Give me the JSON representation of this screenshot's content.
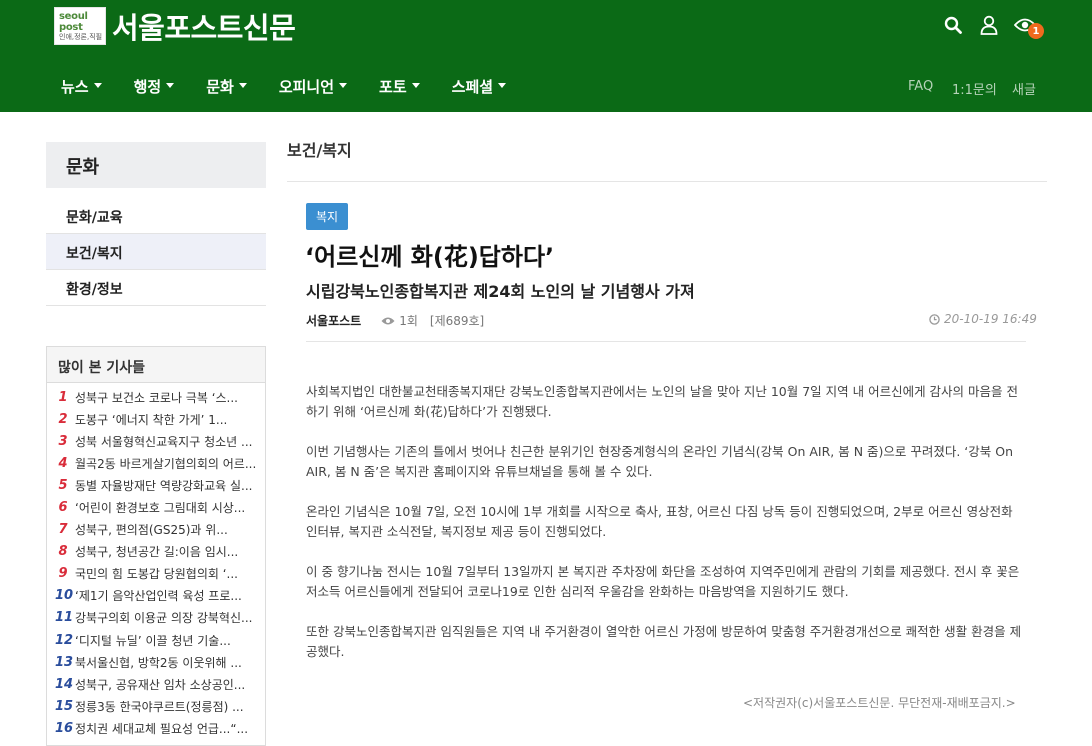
{
  "header": {
    "logo_top": "seoul post",
    "logo_bottom": "인애,정론,직필",
    "site_title": "서울포스트신문",
    "eye_badge": "1",
    "nav": [
      "뉴스",
      "행정",
      "문화",
      "오피니언",
      "포토",
      "스페셜"
    ],
    "util": [
      "FAQ",
      "1:1문의",
      "새글"
    ]
  },
  "sidebar": {
    "title": "문화",
    "items": [
      "문화/교육",
      "보건/복지",
      "환경/정보"
    ],
    "popular_title": "많이 본 기사들",
    "popular": [
      {
        "num": "1",
        "text": "성북구 보건소 코로나 극복 ‘스..."
      },
      {
        "num": "2",
        "text": "도봉구 ‘에너지 착한 가게’ 1..."
      },
      {
        "num": "3",
        "text": "성북 서울형혁신교육지구 청소년 ..."
      },
      {
        "num": "4",
        "text": "월곡2동 바르게살기협의회의 어르..."
      },
      {
        "num": "5",
        "text": "동별 자율방재단 역량강화교육 실..."
      },
      {
        "num": "6",
        "text": "‘어린이 환경보호 그림대회 시상..."
      },
      {
        "num": "7",
        "text": "성북구, 편의점(GS25)과 위..."
      },
      {
        "num": "8",
        "text": "성북구, 청년공간 길:이음 임시..."
      },
      {
        "num": "9",
        "text": "국민의 힘 도봉갑 당원협의회 ‘..."
      },
      {
        "num": "10",
        "text": "‘제1기 음악산업인력 육성 프로..."
      },
      {
        "num": "11",
        "text": "강북구의회 이용균 의장 강북혁신..."
      },
      {
        "num": "12",
        "text": "‘디지털 뉴딜’ 이끌 청년 기술..."
      },
      {
        "num": "13",
        "text": "북서울신협, 방학2동 이웃위해 ..."
      },
      {
        "num": "14",
        "text": "성북구, 공유재산 임차 소상공인..."
      },
      {
        "num": "15",
        "text": "정릉3동 한국야쿠르트(정릉점) ..."
      },
      {
        "num": "16",
        "text": "정치권 세대교체 필요성 언급...“..."
      }
    ]
  },
  "article": {
    "section": "보건/복지",
    "tag": "복지",
    "title": "‘어르신께 화(花)답하다’",
    "subtitle": "시립강북노인종합복지관 제24회 노인의 날 기념행사 가져",
    "author": "서울포스트",
    "views": "1회",
    "issue": "[제689호]",
    "date": "20-10-19 16:49",
    "paragraphs": [
      "사회복지법인 대한불교천태종복지재단 강북노인종합복지관에서는 노인의 날을 맞아 지난 10월 7일 지역 내 어르신에게 감사의 마음을 전하기 위해 ‘어르신께 화(花)답하다’가 진행됐다.",
      " 이번 기념행사는 기존의 틀에서 벗어나 친근한 분위기인 현장중계형식의 온라인 기념식(강북 On AIR, 봄 N 줌)으로 꾸려졌다. ‘강북 On AIR, 봄 N 줌’은 복지관 홈페이지와 유튜브채널을 통해 볼 수 있다.",
      " 온라인 기념식은 10월 7일, 오전 10시에 1부 개회를 시작으로 축사, 표창, 어르신 다짐 낭독 등이 진행되었으며, 2부로 어르신 영상전화 인터뷰, 복지관 소식전달, 복지정보 제공 등이 진행되었다.",
      " 이 중 향기나눔 전시는 10월 7일부터 13일까지 본 복지관 주차장에 화단을 조성하여 지역주민에게 관람의 기회를 제공했다. 전시 후 꽃은 저소득 어르신들에게 전달되어 코로나19로 인한 심리적 우울감을 완화하는 마음방역을 지원하기도 했다.",
      " 또한 강북노인종합복지관 임직원들은 지역 내 주거환경이 열악한 어르신 가정에 방문하여 맞춤형 주거환경개선으로 쾌적한 생활 환경을 제공했다."
    ],
    "copyright": "<저작권자(c)서울포스트신문. 무단전재-재배포금지.>"
  },
  "colors": {
    "header_bg": "#0b6a16",
    "tag_bg": "#3b8fd1",
    "badge": "#ef6a1e",
    "rank_red": "#d92c3a",
    "rank_blue": "#2a4d9c"
  }
}
